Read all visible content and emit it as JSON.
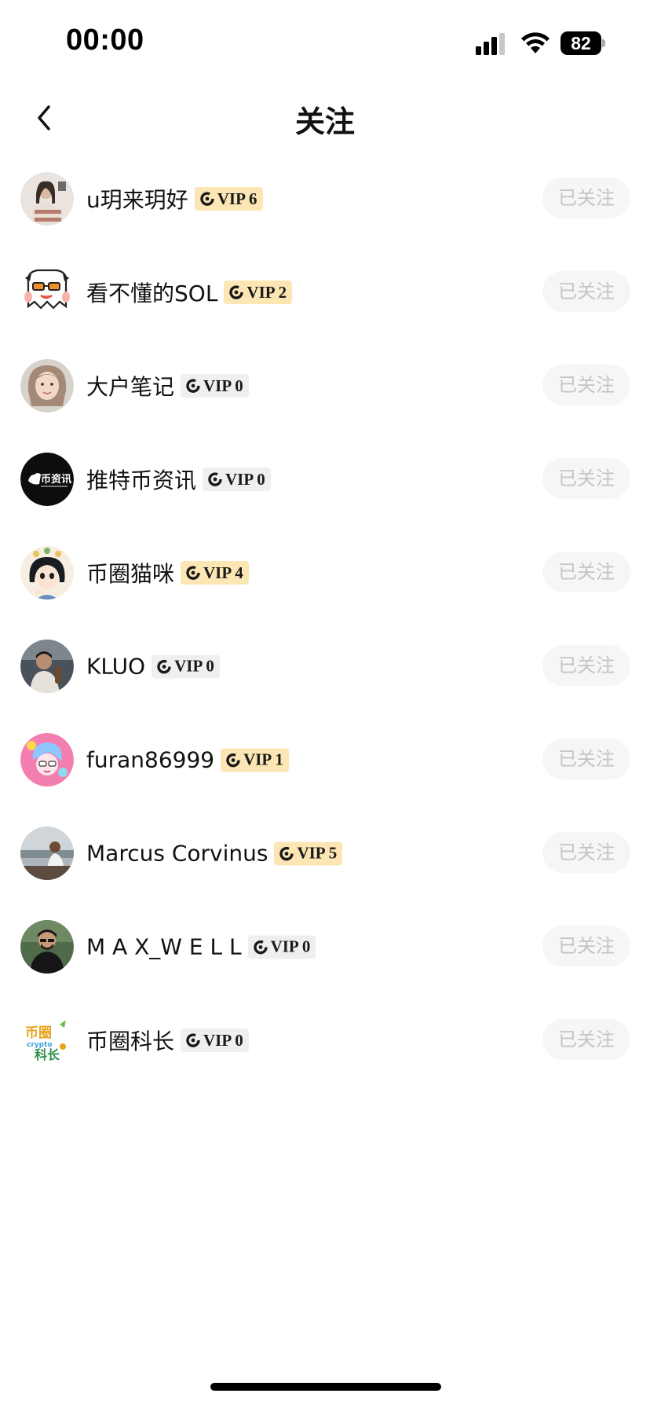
{
  "status_bar": {
    "time": "00:00",
    "battery": "82",
    "icons": [
      "signal-icon",
      "wifi-icon",
      "battery-icon"
    ]
  },
  "header": {
    "title": "关注",
    "back_icon": "chevron-left-icon"
  },
  "colors": {
    "vip_gold_bg": "#fbe6b4",
    "vip_zero_bg": "#efefef",
    "follow_button_bg": "#f6f6f6",
    "follow_button_text": "#c4c4c4"
  },
  "following": [
    {
      "name": "u玥来玥好",
      "vip": "VIP 6",
      "button": "已关注",
      "avatar": "avatar-photo-girl"
    },
    {
      "name": "看不懂的SOL",
      "vip": "VIP 2",
      "button": "已关注",
      "avatar": "avatar-ghost-cartoon"
    },
    {
      "name": "大户笔记",
      "vip": "VIP 0",
      "button": "已关注",
      "avatar": "avatar-photo-girl"
    },
    {
      "name": "推特币资讯",
      "vip": "VIP 0",
      "button": "已关注",
      "avatar": "avatar-logo-币资讯"
    },
    {
      "name": "币圈猫咪",
      "vip": "VIP 4",
      "button": "已关注",
      "avatar": "avatar-anime-girl"
    },
    {
      "name": "KLUO",
      "vip": "VIP 0",
      "button": "已关注",
      "avatar": "avatar-photo-person"
    },
    {
      "name": "furan86999",
      "vip": "VIP 1",
      "button": "已关注",
      "avatar": "avatar-anime-pink"
    },
    {
      "name": "Marcus Corvinus",
      "vip": "VIP 5",
      "button": "已关注",
      "avatar": "avatar-photo-man"
    },
    {
      "name": "M A X_W E L L",
      "vip": "VIP 0",
      "button": "已关注",
      "avatar": "avatar-photo-man"
    },
    {
      "name": "币圈科长",
      "vip": "VIP 0",
      "button": "已关注",
      "avatar": "avatar-logo-币圈科长"
    }
  ]
}
